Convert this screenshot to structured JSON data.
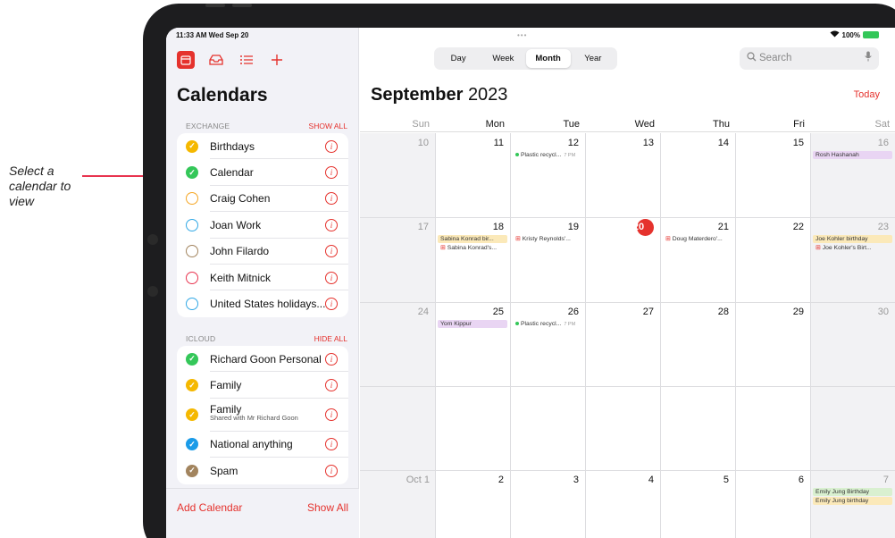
{
  "callout": {
    "text": "Select a calendar to view"
  },
  "status": {
    "time_date": "11:33 AM  Wed Sep 20",
    "dots": "•••",
    "battery": "100%"
  },
  "sidebar": {
    "title": "Calendars",
    "exchange": {
      "header": "EXCHANGE",
      "action": "SHOW ALL",
      "items": [
        {
          "label": "Birthdays",
          "checked": true,
          "color": "#f5b800"
        },
        {
          "label": "Calendar",
          "checked": true,
          "color": "#34c759"
        },
        {
          "label": "Craig Cohen",
          "checked": false,
          "color": "#f5a623"
        },
        {
          "label": "Joan Work",
          "checked": false,
          "color": "#31a8e5"
        },
        {
          "label": "John Filardo",
          "checked": false,
          "color": "#a2845e"
        },
        {
          "label": "Keith Mitnick",
          "checked": false,
          "color": "#e8344f"
        },
        {
          "label": "United States holidays...",
          "checked": false,
          "color": "#31a8e5"
        }
      ]
    },
    "icloud": {
      "header": "ICLOUD",
      "action": "HIDE ALL",
      "items": [
        {
          "label": "Richard Goon Personal",
          "checked": true,
          "color": "#34c759"
        },
        {
          "label": "Family",
          "checked": true,
          "color": "#f5b800"
        },
        {
          "label": "Family",
          "sublabel": "Shared with Mr Richard Goon",
          "checked": true,
          "color": "#f5b800"
        },
        {
          "label": "National anything",
          "checked": true,
          "color": "#1a9be8"
        },
        {
          "label": "Spam",
          "checked": true,
          "color": "#a2845e"
        }
      ]
    },
    "add_calendar": "Add Calendar",
    "show_all": "Show All"
  },
  "main": {
    "views": [
      "Day",
      "Week",
      "Month",
      "Year"
    ],
    "active_view": "Month",
    "search_placeholder": "Search",
    "month": "September",
    "year": "2023",
    "today_label": "Today",
    "weekdays": [
      "Sun",
      "Mon",
      "Tue",
      "Wed",
      "Thu",
      "Fri",
      "Sat"
    ],
    "weeks": [
      [
        "10",
        "11",
        "12",
        "13",
        "14",
        "15",
        "16"
      ],
      [
        "17",
        "18",
        "19",
        "20",
        "21",
        "22",
        "23"
      ],
      [
        "24",
        "25",
        "26",
        "27",
        "28",
        "29",
        "30"
      ],
      [
        "",
        "",
        "",
        "",
        "",
        "",
        ""
      ],
      [
        "Oct 1",
        "2",
        "3",
        "4",
        "5",
        "6",
        "7"
      ]
    ],
    "today_cell": "20",
    "events": [
      {
        "week": 0,
        "day": 2,
        "slot": 0,
        "kind": "dot",
        "text": "Plastic recycl...",
        "time": "7 PM",
        "color": "#34c759"
      },
      {
        "week": 0,
        "day": 6,
        "slot": 0,
        "kind": "bar",
        "text": "Rosh Hashanah",
        "bg": "#e9d5f3"
      },
      {
        "week": 1,
        "day": 1,
        "slot": 0,
        "kind": "bar",
        "text": "Sabina Konrad bir...",
        "bg": "#fbe9b9"
      },
      {
        "week": 1,
        "day": 1,
        "slot": 1,
        "kind": "gift",
        "text": "Sabina Konrad's..."
      },
      {
        "week": 1,
        "day": 2,
        "slot": 0,
        "kind": "gift",
        "text": "Kristy Reynolds'..."
      },
      {
        "week": 1,
        "day": 4,
        "slot": 0,
        "kind": "gift",
        "text": "Doug Materdero'..."
      },
      {
        "week": 1,
        "day": 6,
        "slot": 0,
        "kind": "bar",
        "text": "Joe Kohler birthday",
        "bg": "#fbe9b9"
      },
      {
        "week": 1,
        "day": 6,
        "slot": 1,
        "kind": "gift",
        "text": "Joe Kohler's Birt..."
      },
      {
        "week": 2,
        "day": 1,
        "slot": 0,
        "kind": "bar",
        "text": "Yom Kippur",
        "bg": "#e9d5f3"
      },
      {
        "week": 2,
        "day": 2,
        "slot": 0,
        "kind": "dot",
        "text": "Plastic recycl...",
        "time": "7 PM",
        "color": "#34c759"
      },
      {
        "week": 4,
        "day": 6,
        "slot": 0,
        "kind": "bar",
        "text": "Emily Jung Birthday",
        "bg": "#d9f0d0"
      },
      {
        "week": 4,
        "day": 6,
        "slot": 1,
        "kind": "bar",
        "text": "Emily Jung birthday",
        "bg": "#fbe9b9"
      }
    ]
  }
}
